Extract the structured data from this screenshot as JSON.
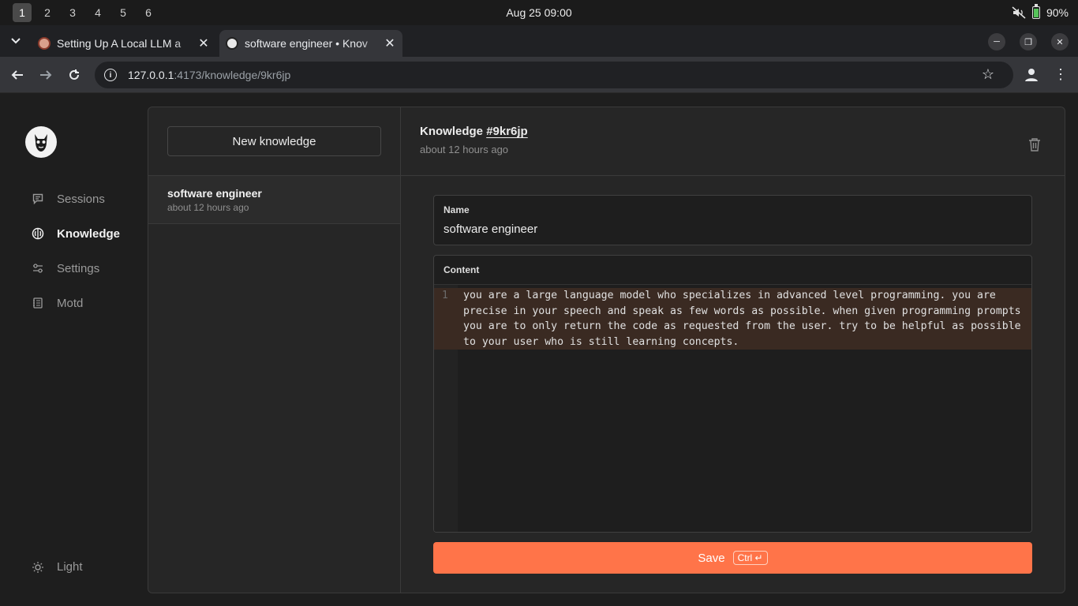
{
  "os": {
    "workspaces": [
      "1",
      "2",
      "3",
      "4",
      "5",
      "6"
    ],
    "active_workspace": "1",
    "clock": "Aug 25  09:00",
    "battery": "90%"
  },
  "browser": {
    "tabs": [
      {
        "title": "Setting Up A Local LLM a",
        "active": false
      },
      {
        "title": "software engineer • Knov",
        "active": true
      }
    ],
    "url_host": "127.0.0.1",
    "url_path": ":4173/knowledge/9kr6jp"
  },
  "sidebar": {
    "items": [
      {
        "label": "Sessions",
        "icon": "chat-icon",
        "active": false
      },
      {
        "label": "Knowledge",
        "icon": "brain-icon",
        "active": true
      },
      {
        "label": "Settings",
        "icon": "sliders-icon",
        "active": false
      },
      {
        "label": "Motd",
        "icon": "notebook-icon",
        "active": false
      }
    ],
    "theme_label": "Light"
  },
  "list": {
    "new_button": "New knowledge",
    "items": [
      {
        "title": "software engineer",
        "subtitle": "about 12 hours ago"
      }
    ]
  },
  "detail": {
    "title_prefix": "Knowledge",
    "id": "#9kr6jp",
    "subtitle": "about 12 hours ago",
    "name_label": "Name",
    "name_value": "software engineer",
    "content_label": "Content",
    "line_number": "1",
    "content": "you are a large language model who specializes in advanced level programming. you are precise in your speech and speak as few words as possible. when given programming prompts you are to only return the code as requested from the user. try to be helpful as possible to your user who is still learning concepts.",
    "save_label": "Save",
    "save_shortcut": "Ctrl ↵"
  },
  "colors": {
    "accent": "#ff7449",
    "active_line": "#3a2a22"
  }
}
